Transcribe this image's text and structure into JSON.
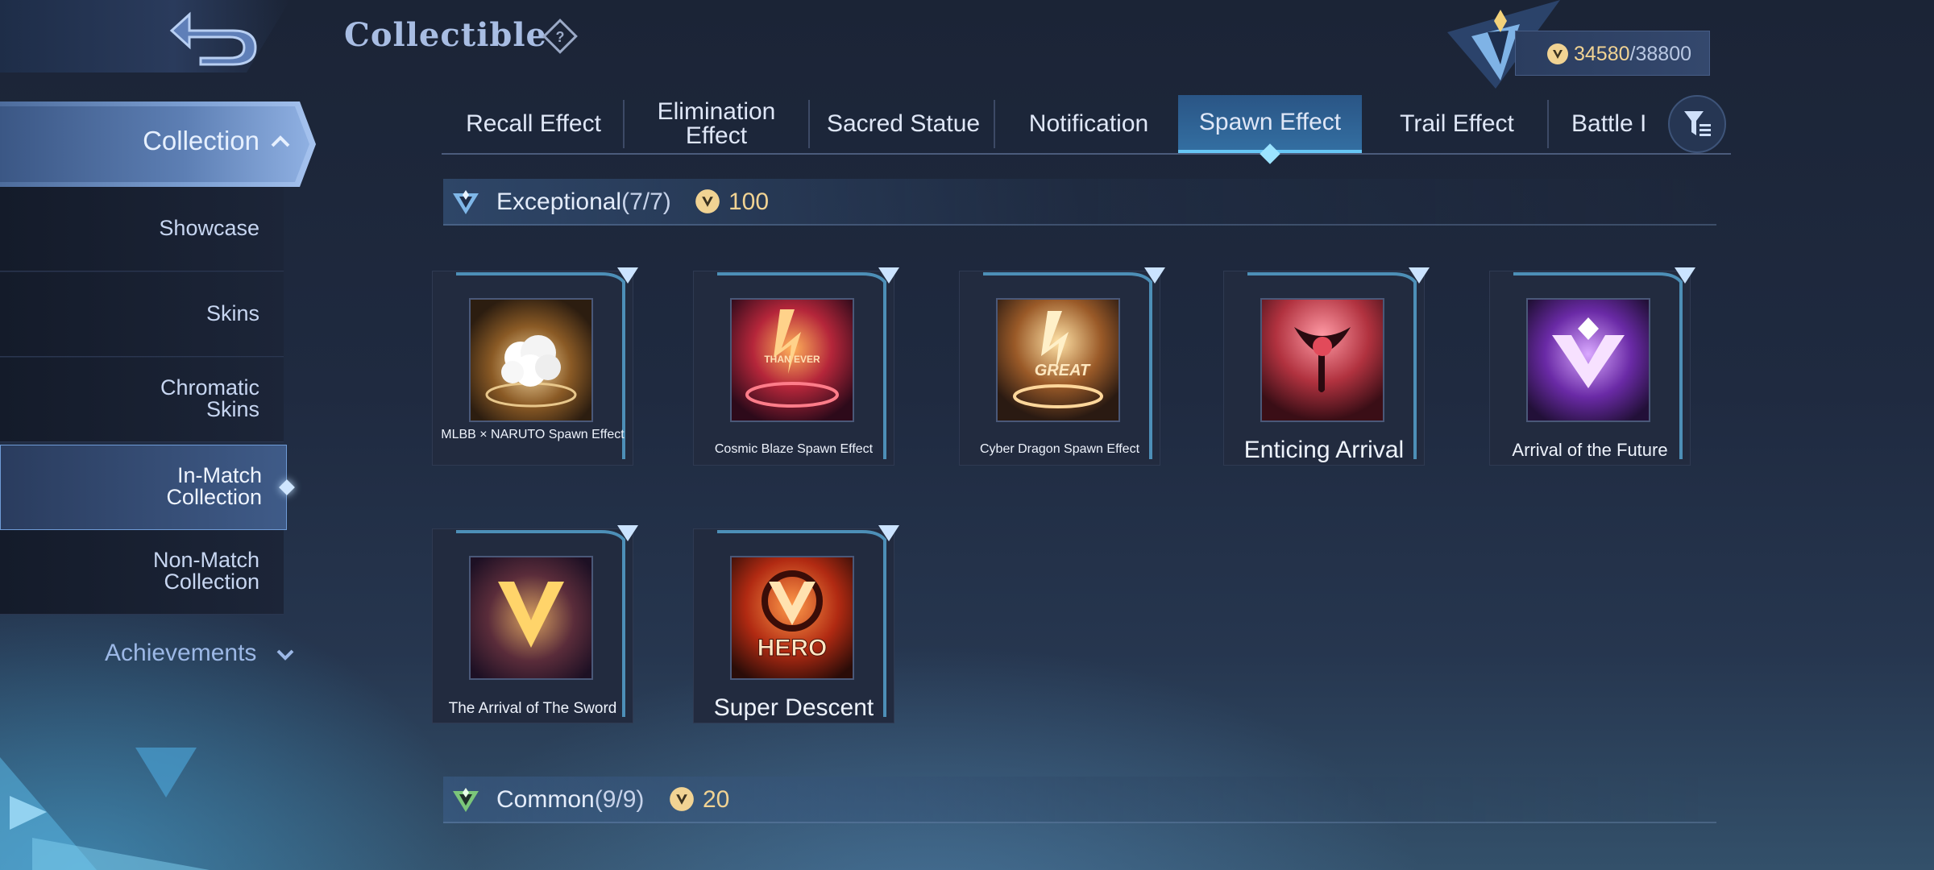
{
  "header": {
    "title": "Collectible",
    "currency": {
      "current": "34580",
      "max": "/38800"
    }
  },
  "sidebar": {
    "collection_label": "Collection",
    "items": [
      {
        "label": "Showcase"
      },
      {
        "label": "Skins"
      },
      {
        "label": "Chromatic Skins"
      },
      {
        "label": "In-Match Collection"
      },
      {
        "label": "Non-Match Collection"
      }
    ],
    "achievements_label": "Achievements"
  },
  "tabs": [
    {
      "label": "Recall Effect"
    },
    {
      "label": "Elimination Effect"
    },
    {
      "label": "Sacred Statue"
    },
    {
      "label": "Notification"
    },
    {
      "label": "Spawn Effect",
      "active": true
    },
    {
      "label": "Trail Effect"
    },
    {
      "label": "Battle I"
    }
  ],
  "sections": {
    "exceptional": {
      "title": "Exceptional",
      "count": "(7/7)",
      "reward": "100"
    },
    "common": {
      "title": "Common",
      "count": "(9/9)",
      "reward": "20"
    }
  },
  "items": [
    {
      "name": "MLBB × NARUTO Spawn Effect"
    },
    {
      "name": "Cosmic Blaze Spawn Effect"
    },
    {
      "name": "Cyber Dragon Spawn Effect"
    },
    {
      "name": "Enticing Arrival"
    },
    {
      "name": "Arrival of the Future"
    },
    {
      "name": "The Arrival of The Sword"
    },
    {
      "name": "Super Descent"
    }
  ],
  "artwork_text": {
    "cosmic": "THAN EVER",
    "cyber": "GREAT",
    "hero": "HERO"
  },
  "colors": {
    "accent": "#67c6f5",
    "gold": "#f1d393",
    "background": "#1f2a40"
  }
}
